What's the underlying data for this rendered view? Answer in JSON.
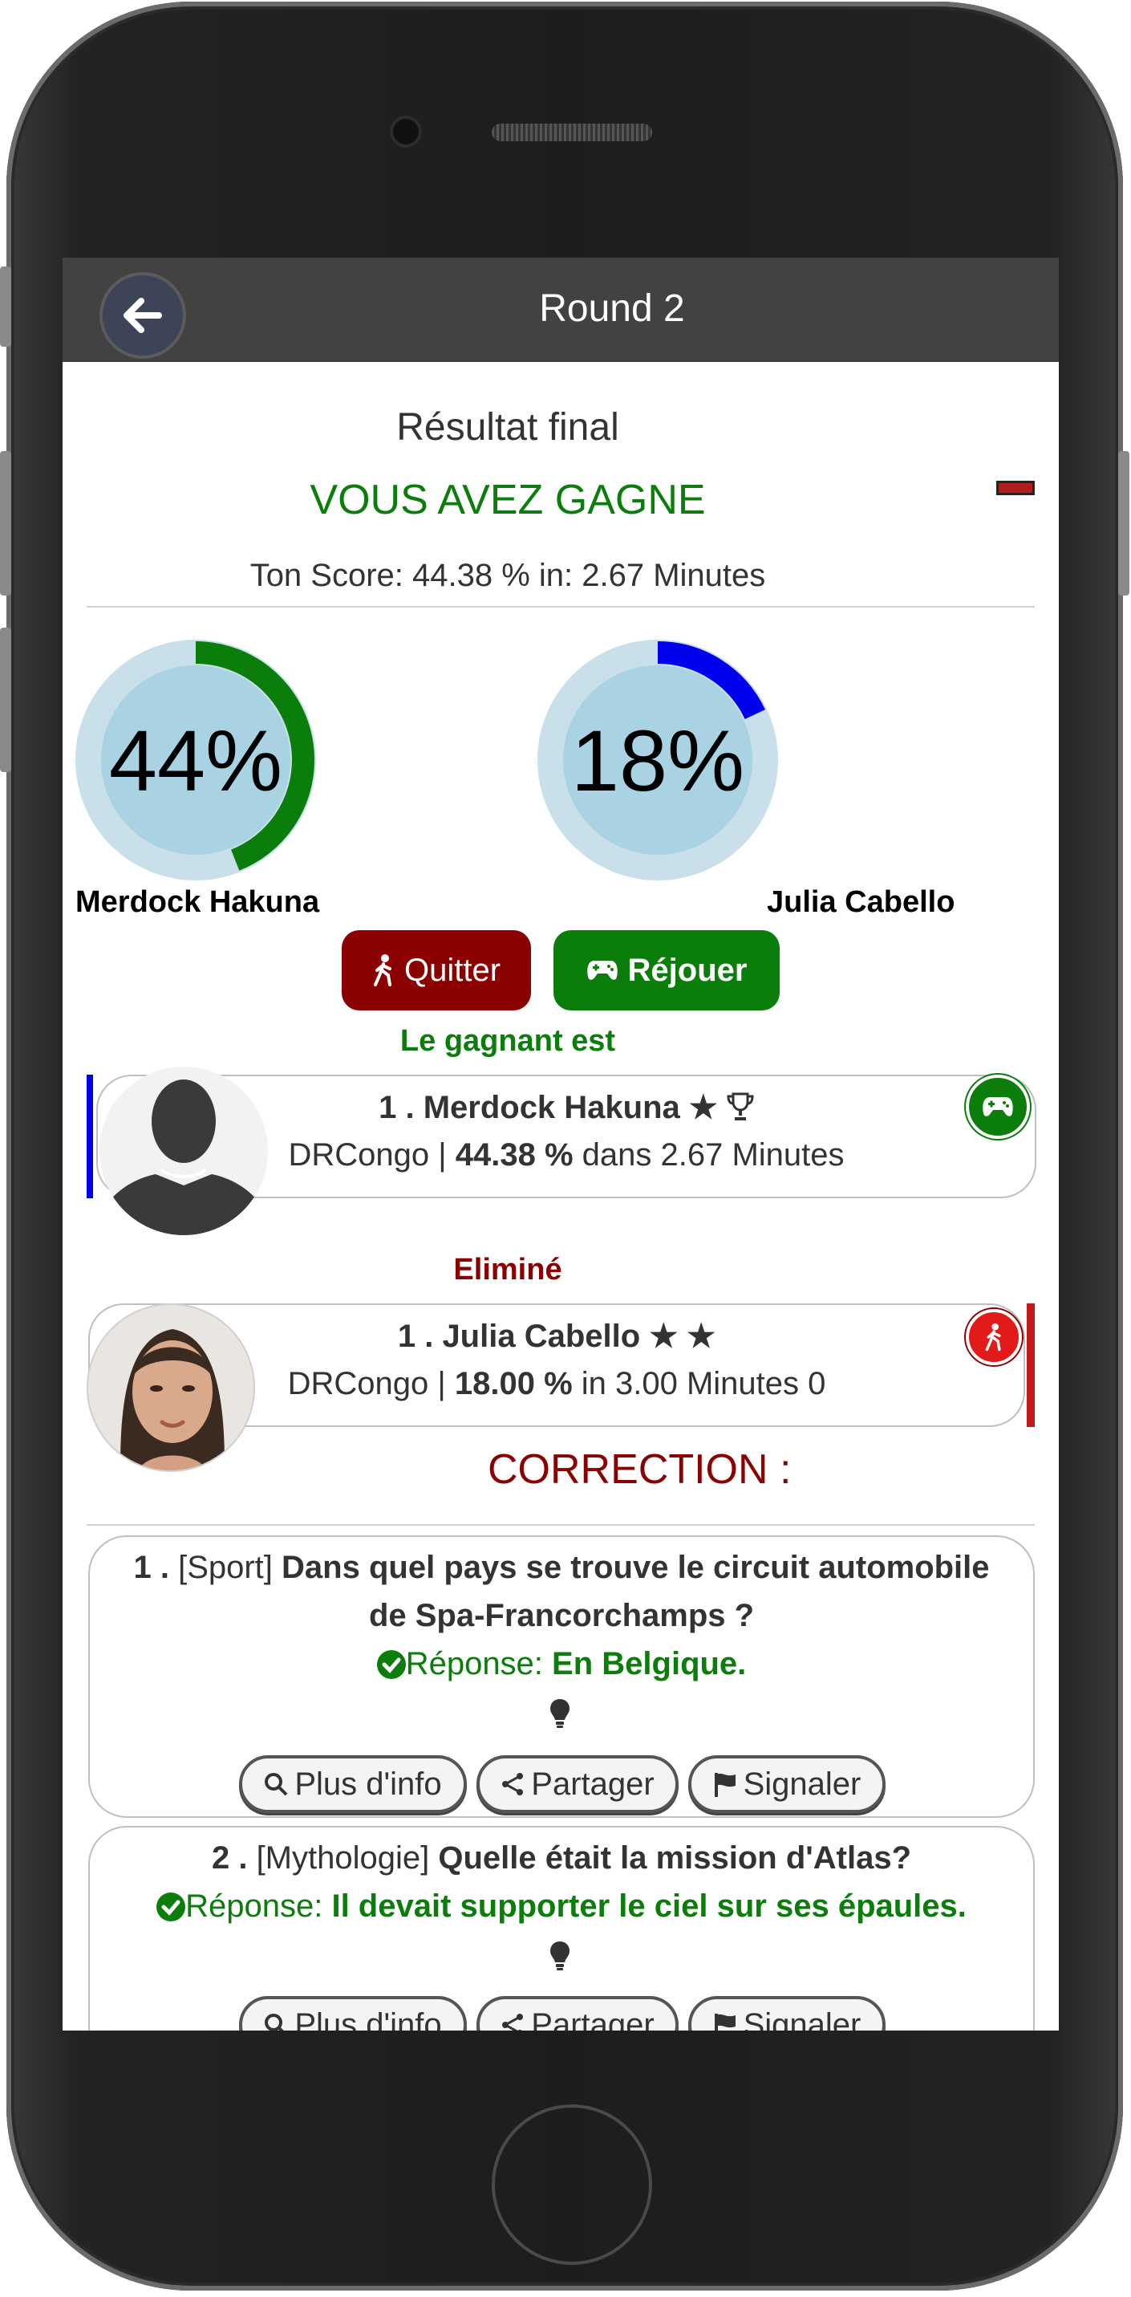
{
  "header": {
    "title": "Round 2"
  },
  "result": {
    "heading": "Résultat final",
    "status": "VOUS AVEZ GAGNE",
    "score_line": "Ton Score: 44.38 % in: 2.67 Minutes"
  },
  "players": [
    {
      "name": "Merdock Hakuna",
      "percent_label": "44%",
      "percent": 44,
      "ring_color": "#0a7d0a"
    },
    {
      "name": "Julia Cabello",
      "percent_label": "18%",
      "percent": 18,
      "ring_color": "#0000ee"
    }
  ],
  "actions": {
    "quit_label": "Quitter",
    "replay_label": "Réjouer"
  },
  "winner_section": {
    "heading": "Le gagnant est",
    "entry": {
      "rank": "1 .",
      "name": "Merdock Hakuna",
      "country": "DRCongo |",
      "score": "44.38 %",
      "time_text": "dans 2.67 Minutes"
    }
  },
  "eliminated_section": {
    "heading": "Eliminé",
    "entry": {
      "rank": "1 .",
      "name": "Julia Cabello",
      "country": "DRCongo |",
      "score": "18.00 %",
      "time_text": "in 3.00 Minutes 0"
    }
  },
  "correction": {
    "heading": "CORRECTION :",
    "answer_prefix": "Réponse:",
    "buttons": {
      "info": "Plus d'info",
      "share": "Partager",
      "report": "Signaler"
    },
    "questions": [
      {
        "number": "1 .",
        "category": "[Sport]",
        "question_line1": "Dans quel pays se trouve le circuit automobile",
        "question_line2": "de Spa-Francorchamps ?",
        "answer": "En Belgique."
      },
      {
        "number": "2 .",
        "category": "[Mythologie]",
        "question_line1": "Quelle était la mission d'Atlas?",
        "answer": "Il devait supporter le ciel sur ses épaules."
      }
    ]
  },
  "colors": {
    "win": "#0a7d0a",
    "lose": "#8b0000",
    "topbar": "#424242",
    "ring_track": "#c9e0ea",
    "ring_fill": "#a9d3e3"
  }
}
